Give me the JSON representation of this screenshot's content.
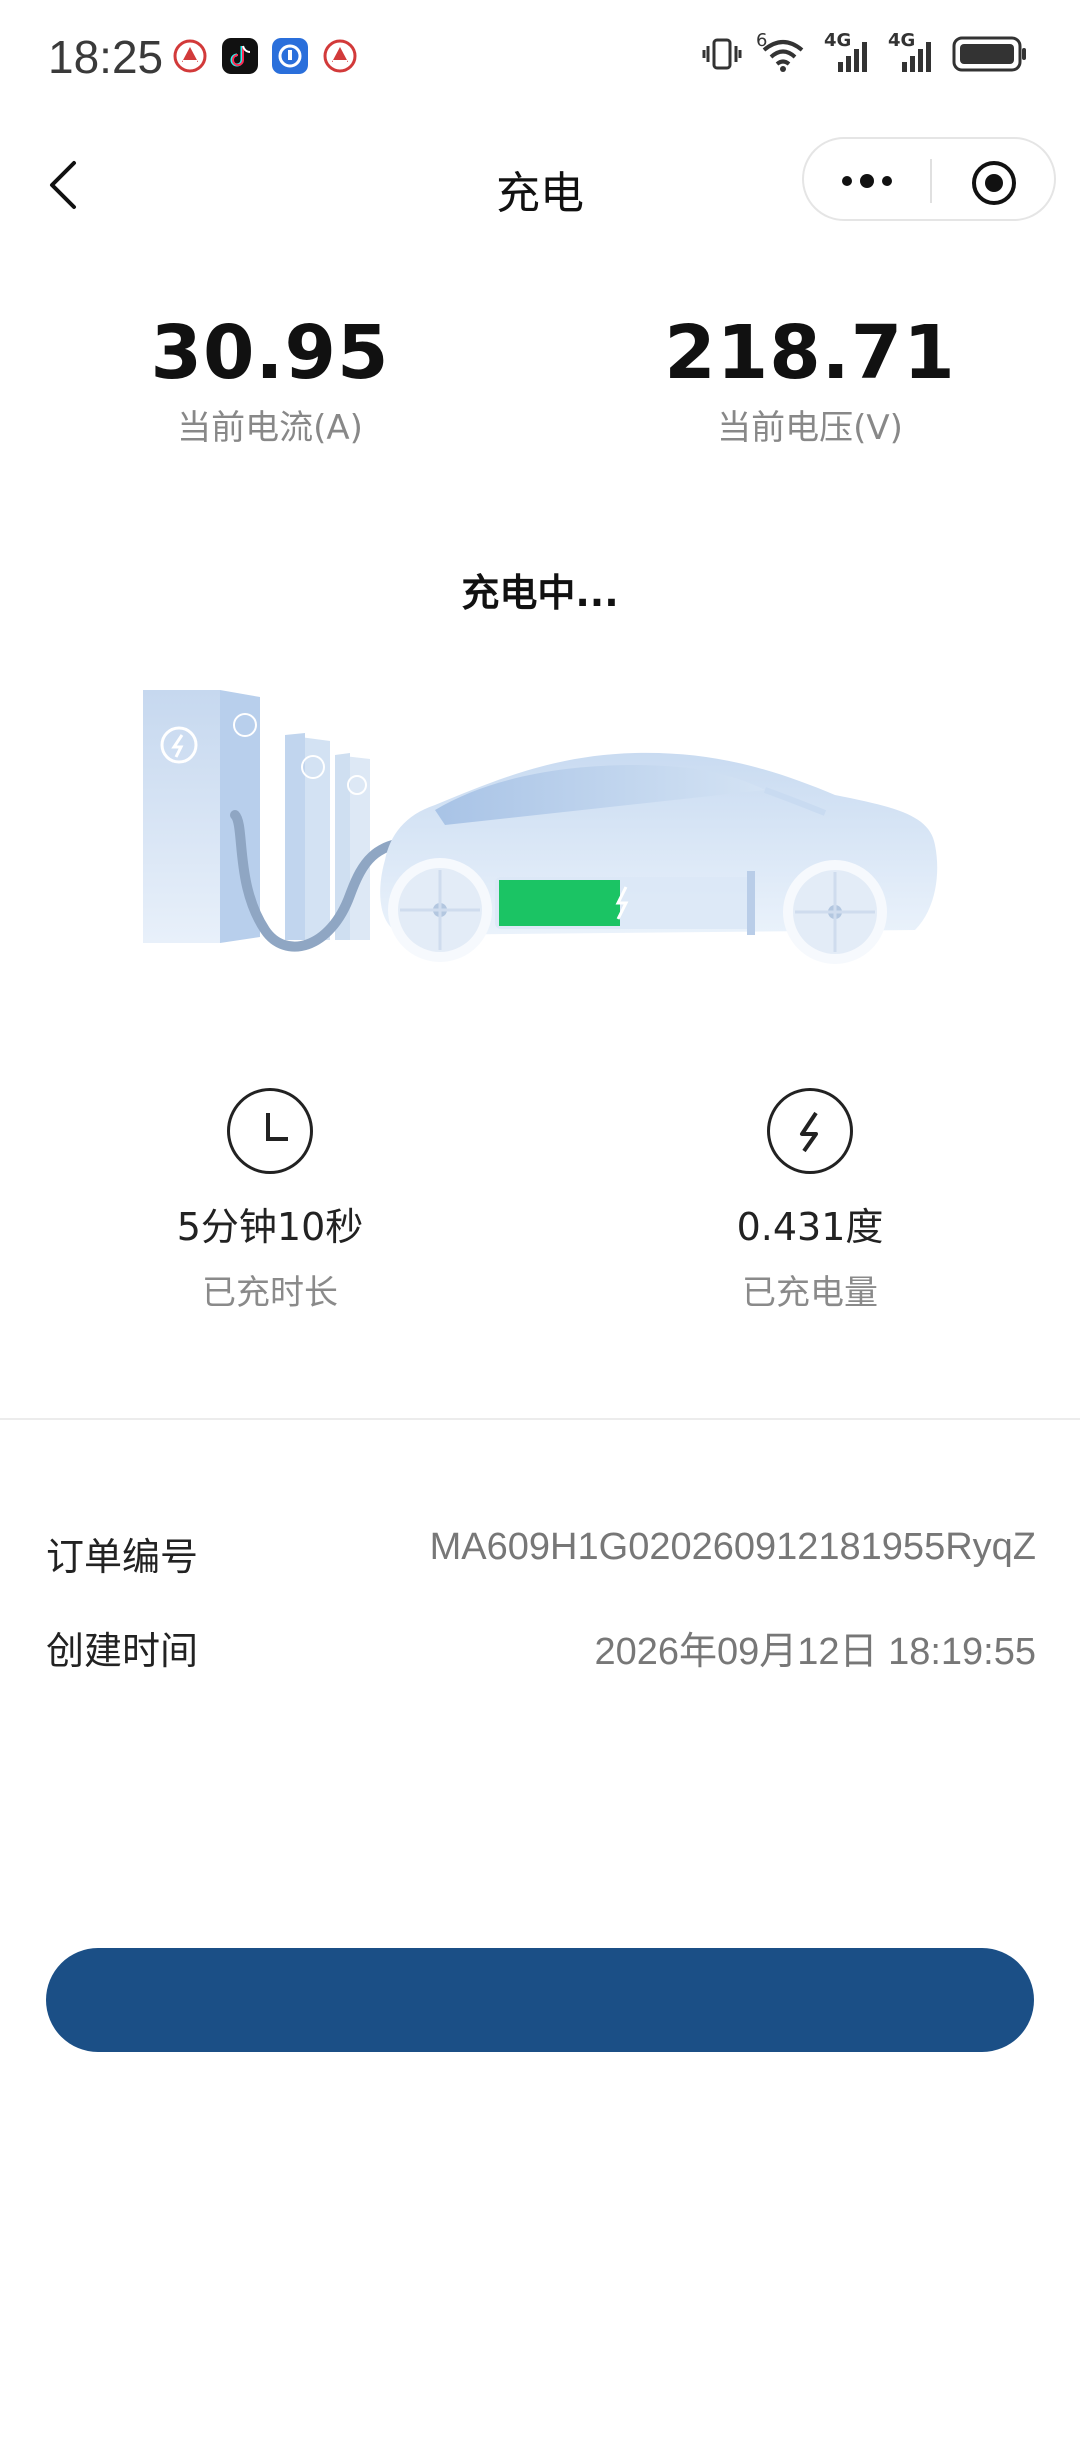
{
  "status_bar": {
    "time": "18:25",
    "network_labels": [
      "4G",
      "4G"
    ],
    "signal_icon_text": "6"
  },
  "nav": {
    "title": "充电",
    "back_icon": "chevron-left-icon",
    "more_icon": "more-dots-icon",
    "close_icon": "target-circle-icon"
  },
  "stats": [
    {
      "value": "30.95",
      "label": "当前电流(A)"
    },
    {
      "value": "218.71",
      "label": "当前电压(V)"
    }
  ],
  "charging_status": "充电中...",
  "battery": {
    "level": 0.48,
    "fill_color": "#1bc464"
  },
  "info": [
    {
      "icon": "clock-icon",
      "value": "5分钟10秒",
      "label": "已充时长"
    },
    {
      "icon": "lightning-icon",
      "value": "0.431度",
      "label": "已充电量"
    }
  ],
  "order": {
    "order_no_label": "订单编号",
    "order_no": "MA609H1G020260912181955RyqZ",
    "created_label": "创建时间",
    "created": "2026年09月12日 18:19:55"
  },
  "action_button": {
    "label": "",
    "color": "#1b4f86"
  },
  "colors": {
    "accent": "#1b4f86",
    "battery_green": "#1bc464",
    "car_light": "#dbe7f6"
  }
}
